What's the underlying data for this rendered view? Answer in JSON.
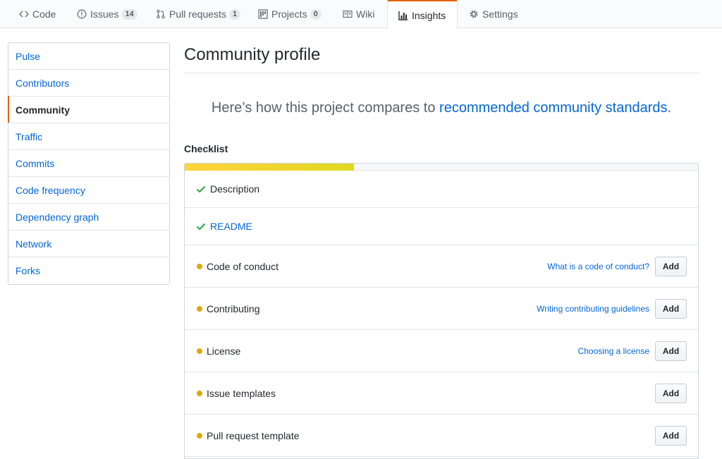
{
  "tabs": [
    {
      "label": "Code",
      "icon": "code-icon"
    },
    {
      "label": "Issues",
      "icon": "issue-icon",
      "count": "14"
    },
    {
      "label": "Pull requests",
      "icon": "pull-request-icon",
      "count": "1"
    },
    {
      "label": "Projects",
      "icon": "project-icon",
      "count": "0"
    },
    {
      "label": "Wiki",
      "icon": "book-icon"
    },
    {
      "label": "Insights",
      "icon": "graph-icon",
      "selected": true
    },
    {
      "label": "Settings",
      "icon": "gear-icon"
    }
  ],
  "menu": {
    "items": [
      {
        "label": "Pulse"
      },
      {
        "label": "Contributors"
      },
      {
        "label": "Community",
        "active": true
      },
      {
        "label": "Traffic"
      },
      {
        "label": "Commits"
      },
      {
        "label": "Code frequency"
      },
      {
        "label": "Dependency graph"
      },
      {
        "label": "Network"
      },
      {
        "label": "Forks"
      }
    ]
  },
  "main": {
    "title": "Community profile",
    "lead_text": "Here’s how this project compares to",
    "lead_link": "recommended community standards",
    "lead_end": ".",
    "checklist_heading": "Checklist",
    "progress_fraction": 0.33,
    "items": [
      {
        "label": "Description",
        "status": "done"
      },
      {
        "label": "README",
        "status": "done"
      },
      {
        "label": "Code of conduct",
        "status": "missing",
        "help": "What is a code of conduct?",
        "action": "Add"
      },
      {
        "label": "Contributing",
        "status": "missing",
        "help": "Writing contributing guidelines",
        "action": "Add"
      },
      {
        "label": "License",
        "status": "missing",
        "help": "Choosing a license",
        "action": "Add"
      },
      {
        "label": "Issue templates",
        "status": "missing",
        "action": "Add"
      },
      {
        "label": "Pull request template",
        "status": "missing",
        "action": "Add"
      }
    ]
  },
  "colors": {
    "accent": "#e36209",
    "link": "#0366d6",
    "check": "#28a745",
    "pending_dot": "#dbab09",
    "progress": "#ffd33d"
  }
}
